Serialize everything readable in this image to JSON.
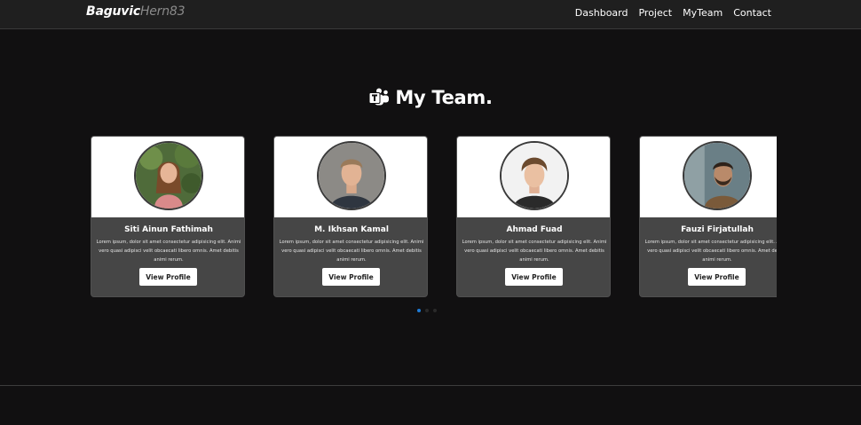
{
  "navbar": {
    "brand_primary": "Baguvic",
    "brand_secondary": "Hern83",
    "links": [
      "Dashboard",
      "Project",
      "MyTeam",
      "Contact"
    ]
  },
  "section": {
    "icon": "microsoft-teams-icon",
    "title": "My Team."
  },
  "team": [
    {
      "name": "Siti Ainun Fathimah",
      "description": "Lorem ipsum, dolor sit amet consectetur adipisicing elit. Animi vero quasi adipisci velit obcaecati libero omnis. Amet debitis animi rerum.",
      "button": "View Profile",
      "avatar": "woman-portrait-photo"
    },
    {
      "name": "M. Ikhsan Kamal",
      "description": "Lorem ipsum, dolor sit amet consectetur adipisicing elit. Animi vero quasi adipisci velit obcaecati libero omnis. Amet debitis animi rerum.",
      "button": "View Profile",
      "avatar": "man-portrait-photo"
    },
    {
      "name": "Ahmad Fuad",
      "description": "Lorem ipsum, dolor sit amet consectetur adipisicing elit. Animi vero quasi adipisci velit obcaecati libero omnis. Amet debitis animi rerum.",
      "button": "View Profile",
      "avatar": "young-man-portrait-photo"
    },
    {
      "name": "Fauzi Firjatullah",
      "description": "Lorem ipsum, dolor sit amet consectetur adipisicing elit. Animi vero quasi adipisci velit obcaecati libero omnis. Amet debitis animi rerum.",
      "button": "View Profile",
      "avatar": "bearded-man-portrait-photo"
    }
  ],
  "carousel": {
    "active_index": 0,
    "dot_count": 3
  },
  "colors": {
    "background": "#111011",
    "navbar": "#1f1f1f",
    "card_bottom": "#464646",
    "card_top": "#ffffff",
    "active_dot": "#1e7bd6"
  }
}
